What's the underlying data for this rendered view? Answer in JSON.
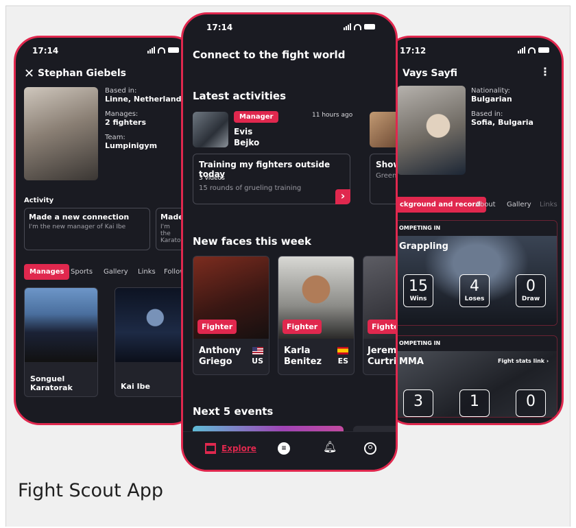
{
  "caption": "Fight Scout App",
  "colors": {
    "accent": "#e0284e",
    "background": "#1a1b22"
  },
  "left_phone": {
    "time": "17:14",
    "title": "Stephan Giebels",
    "info": [
      {
        "label": "Based in:",
        "value": "Linne, Netherlands"
      },
      {
        "label": "Manages:",
        "value": "2 fighters"
      },
      {
        "label": "Team:",
        "value": "Lumpinigym"
      }
    ],
    "activity_heading": "Activity",
    "activities": [
      {
        "title": "Made a new connection",
        "text": "I'm the new manager of Kai Ibe"
      },
      {
        "title": "Made a",
        "text": "I'm the Karator"
      }
    ],
    "tabs": [
      "Manages",
      "Sports",
      "Gallery",
      "Links",
      "Follow"
    ],
    "fighters": [
      "Songuel Karatorak",
      "Kai Ibe"
    ]
  },
  "center_phone": {
    "time": "17:14",
    "heading": "Connect to the fight world",
    "latest_heading": "Latest activities",
    "activity": {
      "badge": "Manager",
      "name": "Evis Bejko",
      "time_ago": "11 hours ago",
      "title": "Training my fighters outside today",
      "videos": "3 videos",
      "desc": "15 rounds of grueling training"
    },
    "peek_activity": {
      "title": "Show",
      "text": "Green"
    },
    "new_faces_heading": "New faces this week",
    "new_faces": [
      {
        "tag": "Fighter",
        "name": "Anthony Griego",
        "country": "US"
      },
      {
        "tag": "Fighter",
        "name": "Karla Benitez",
        "country": "ES"
      },
      {
        "tag": "Fighte",
        "name": "Jerem Curtric",
        "country": ""
      }
    ],
    "events_heading": "Next 5 events",
    "nav": {
      "explore": "Explore"
    }
  },
  "right_phone": {
    "time": "17:12",
    "title": "Vays Sayfi",
    "info": [
      {
        "label": "Nationality:",
        "value": "Bulgarian"
      },
      {
        "label": "Based in:",
        "value": "Sofia, Bulgaria"
      }
    ],
    "tabs": [
      "ckground and record",
      "About",
      "Gallery",
      "Links"
    ],
    "competing_label": "OMPETING IN",
    "grappling": {
      "sport": "Grappling",
      "wins": "15",
      "wins_label": "Wins",
      "loses": "4",
      "loses_label": "Loses",
      "draw": "0",
      "draw_label": "Draw"
    },
    "mma": {
      "sport": "MMA",
      "link": "Fight stats link",
      "a": "3",
      "b": "1",
      "c": "0"
    }
  }
}
